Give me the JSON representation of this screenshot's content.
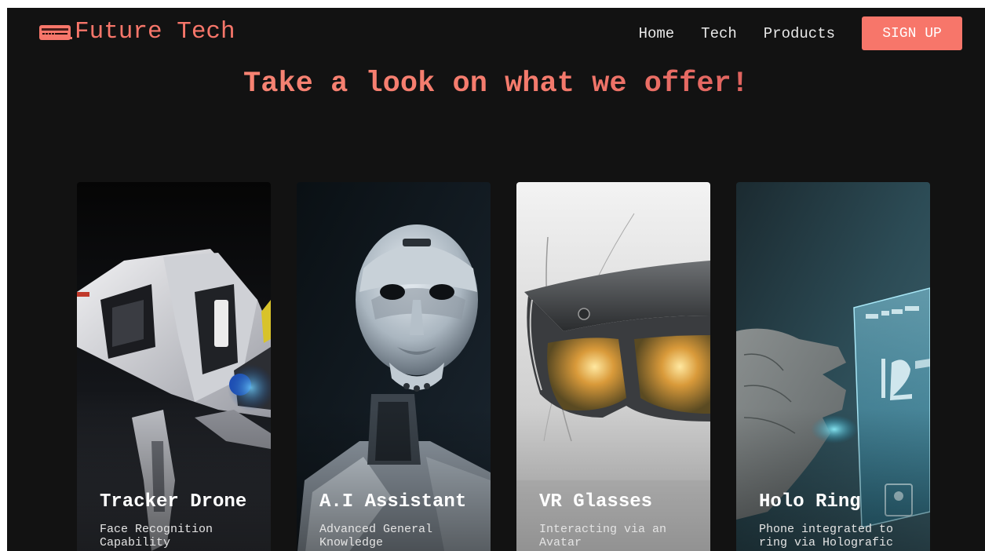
{
  "brand": {
    "name": "Future Tech",
    "accent_color": "#f7766a",
    "icon": "computer-icon"
  },
  "nav": {
    "links": [
      "Home",
      "Tech",
      "Products"
    ],
    "signup_label": "SIGN UP"
  },
  "headline": "Take a look on what we offer!",
  "cards": [
    {
      "title": "Tracker Drone",
      "description": "Face Recognition Capability",
      "image": "robotic-drone-image"
    },
    {
      "title": "A.I Assistant",
      "description": "Advanced General Knowledge",
      "image": "humanoid-robot-image"
    },
    {
      "title": "VR Glasses",
      "description": "Interacting via an Avatar",
      "image": "vr-headset-image"
    },
    {
      "title": "Holo Ring",
      "description": "Phone integrated to ring via Holografic",
      "image": "holographic-phone-image"
    }
  ]
}
